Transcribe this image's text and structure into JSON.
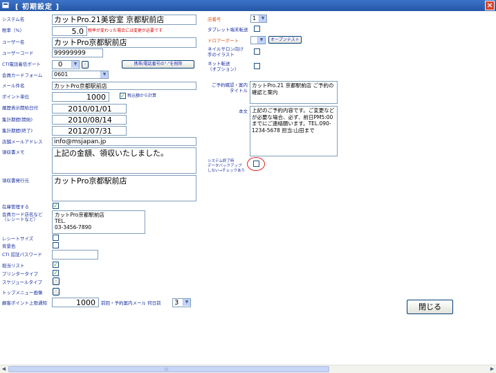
{
  "window": {
    "title": "[ 初期設定 ]",
    "close_icon": "×"
  },
  "left": {
    "system_name": {
      "label": "システム名",
      "value": "カットPro.21美容室  京都駅前店"
    },
    "tax_rate": {
      "label": "税率（%）",
      "value": "5.0",
      "note": "税率が変わった場合には変更が必要です"
    },
    "user_name": {
      "label": "ユーザー名",
      "value": "カットPro京都駅前店"
    },
    "user_code": {
      "label": "ユーザーコード",
      "value": "99999999"
    },
    "cti_port": {
      "label": "CTI電話着信ポート",
      "value": "0",
      "hyphen_button": "携帯/電話番号の\"-\"を削除"
    },
    "member_card": {
      "label": "会員カードフォーム",
      "value": "0601"
    },
    "mail_name": {
      "label": "メール件名",
      "value": "カットPro京都駅前店"
    },
    "point_unit": {
      "label": "ポイント単位",
      "value": "1000",
      "tax_calc_label": "税込額から計算"
    },
    "history_start": {
      "label": "履歴表示開始日付",
      "value": "2010/01/01"
    },
    "agg_start": {
      "label": "集計期間(開始)",
      "value": "2010/08/14"
    },
    "agg_end": {
      "label": "集計期間(終了)",
      "value": "2012/07/31"
    },
    "store_mail": {
      "label": "店舗メールアドレス",
      "value": "info@msjapan.jp"
    },
    "receipt_memo": {
      "label": "領収書メモ",
      "value": "上記の金額、領収いたしました。"
    },
    "receipt_issuer": {
      "label": "領収書発行元",
      "value": "カットPro京都駅前店"
    },
    "stock_mgmt": {
      "label": "在庫管理する"
    },
    "card_store_name": {
      "label_line1": "会員カード店名など",
      "label_line2": "（レシートなど）",
      "value": "カットPro京都駅前店\nTEL.\n03-3456-7890"
    },
    "receipt_size": {
      "label": "レシートサイズ"
    },
    "bg_color": {
      "label": "背景色"
    },
    "cti_password": {
      "label": "CTI 認証パスワード",
      "value": ""
    },
    "staff_list": {
      "label": "担当リスト"
    },
    "printer_type": {
      "label": "プリンタータイプ"
    },
    "schedule_type": {
      "label": "スケジュールタイプ"
    },
    "top_menu_image": {
      "label": "トップメニュー画像"
    },
    "point_notice": {
      "label": "顧客ポイント上限通知",
      "value": "1000",
      "mail_label": "前回・予約案内メール 何日前",
      "days": "3"
    }
  },
  "right": {
    "store_no": {
      "label": "店番号",
      "value": "1"
    },
    "tablet_transfer": {
      "label": "タブレット端末転送"
    },
    "drawer_port": {
      "label": "ドロアーポート",
      "value": "",
      "open_test": "オープンテスト"
    },
    "nail_illust": {
      "label_line1": "ネイルサロン向け",
      "label_line2": "手のイラスト"
    },
    "net_transfer": {
      "label_line1": "ネット転送",
      "label_line2": "（オプション）"
    },
    "reserve_title": {
      "label_line1": "ご予約確認・案内",
      "label_line2": "タイトル",
      "value": "カットPro.21 京都駅前店 ご予約の確認と案内"
    },
    "body": {
      "label": "本文",
      "value": "上記のご予約内容です。ご変更などが必要な場合、必ず、前日PM5:00までにご連絡願います。TEL.090-1234-5678 担当:山田まで"
    },
    "backup": {
      "label_line1": "システム終了時",
      "label_line2": "データバックアップ",
      "label_line3": "しない→チェックあり"
    }
  },
  "close_button": "閉じる",
  "colors": {
    "label": "#1a2fa0",
    "label_orange": "#e05a1a",
    "titlebar": "#2456a6",
    "note": "#e00000"
  }
}
